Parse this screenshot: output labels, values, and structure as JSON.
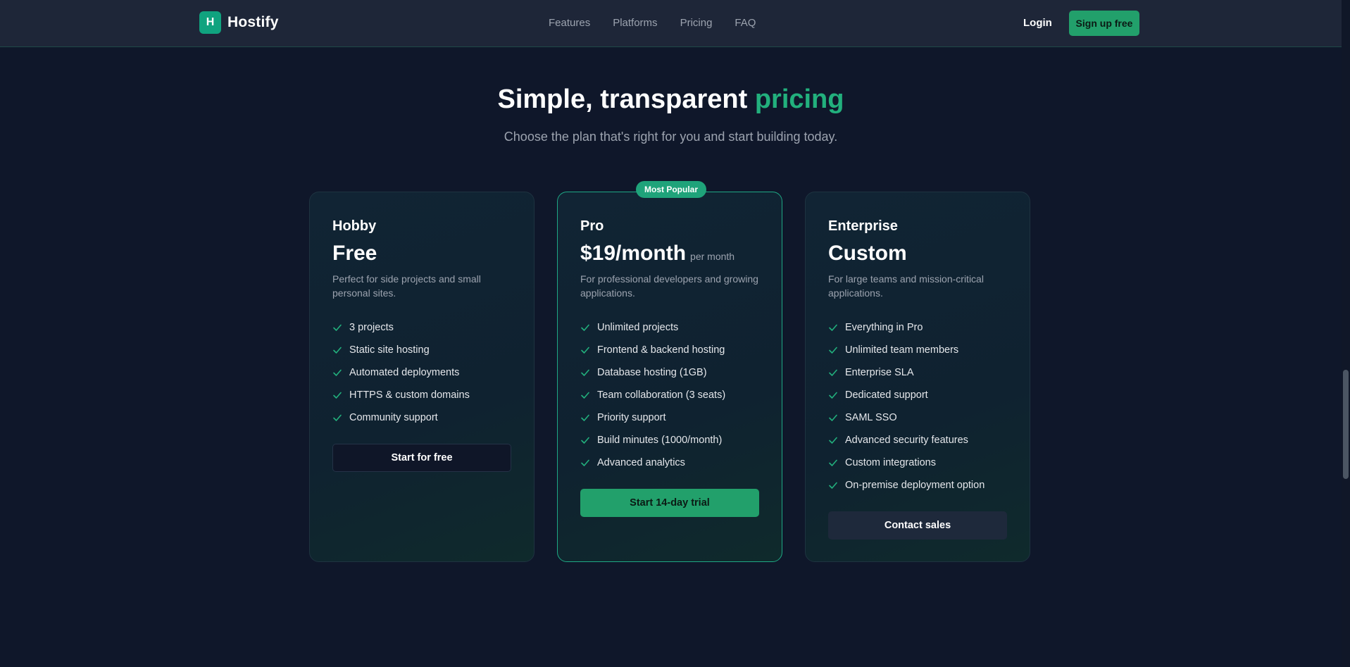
{
  "nav": {
    "logo_letter": "H",
    "brand": "Hostify",
    "links": [
      "Features",
      "Platforms",
      "Pricing",
      "FAQ"
    ],
    "login": "Login",
    "signup": "Sign up free"
  },
  "hero": {
    "title_main": "Simple, transparent ",
    "title_accent": "pricing",
    "subtitle": "Choose the plan that's right for you and start building today."
  },
  "plans": [
    {
      "name": "Hobby",
      "price": "Free",
      "period": "",
      "description": "Perfect for side projects and small personal sites.",
      "features": [
        "3 projects",
        "Static site hosting",
        "Automated deployments",
        "HTTPS & custom domains",
        "Community support"
      ],
      "cta": "Start for free"
    },
    {
      "badge": "Most Popular",
      "name": "Pro",
      "price": "$19/month",
      "period": "per month",
      "description": "For professional developers and growing applications.",
      "features": [
        "Unlimited projects",
        "Frontend & backend hosting",
        "Database hosting (1GB)",
        "Team collaboration (3 seats)",
        "Priority support",
        "Build minutes (1000/month)",
        "Advanced analytics"
      ],
      "cta": "Start 14-day trial"
    },
    {
      "name": "Enterprise",
      "price": "Custom",
      "period": "",
      "description": "For large teams and mission-critical applications.",
      "features": [
        "Everything in Pro",
        "Unlimited team members",
        "Enterprise SLA",
        "Dedicated support",
        "SAML SSO",
        "Advanced security features",
        "Custom integrations",
        "On-premise deployment option"
      ],
      "cta": "Contact sales"
    }
  ],
  "colors": {
    "background": "#0f172a",
    "navbar": "#1e2638",
    "accent": "#22a06b",
    "check": "#22b07d"
  },
  "icons": {
    "feature": "check-icon",
    "logo": "hostify-logo"
  }
}
